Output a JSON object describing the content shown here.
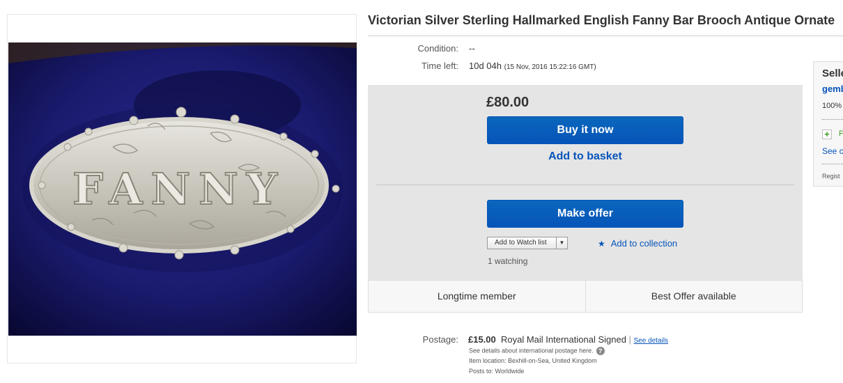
{
  "listing": {
    "title": "Victorian Silver Sterling Hallmarked English Fanny Bar Brooch Antique Ornate"
  },
  "image": {
    "brooch_text": "FANNY"
  },
  "details": {
    "condition_label": "Condition:",
    "condition_value": "--",
    "time_left_label": "Time left:",
    "time_left_value": "10d 04h",
    "time_left_end": "(15 Nov, 2016   15:22:16 GMT)"
  },
  "buy": {
    "price": "£80.00",
    "buy_now_label": "Buy it now",
    "add_to_basket_label": "Add to basket",
    "make_offer_label": "Make offer",
    "watch_list_label": "Add to Watch list",
    "add_to_collection_label": "Add to collection",
    "watching": "1 watching"
  },
  "badges": [
    "Longtime member",
    "Best Offer available"
  ],
  "postage": {
    "label": "Postage:",
    "cost": "£15.00",
    "service": "Royal Mail International Signed",
    "separator": "|",
    "see_details": "See details",
    "international_note": "See details about international postage here.",
    "item_location": "Item location:  Bexhill-on-Sea, United Kingdom",
    "posts_to": "Posts to:  Worldwide"
  },
  "seller": {
    "title": "Selle",
    "name": "gemb",
    "feedback": "100%",
    "follow": "F",
    "see": "See c",
    "registered": "Regist"
  },
  "colors": {
    "accent": "#0654ba",
    "buybox_bg": "#e5e5e5",
    "velvet": "#1a1a6e"
  }
}
